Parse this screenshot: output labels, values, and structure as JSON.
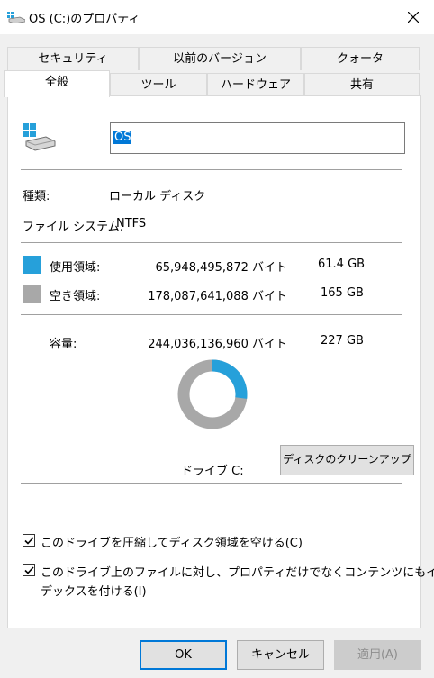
{
  "window": {
    "title": "OS (C:)のプロパティ",
    "icon": "drive-icon",
    "close_icon": "close-icon"
  },
  "tabs_row1": [
    {
      "label": "セキュリティ"
    },
    {
      "label": "以前のバージョン"
    },
    {
      "label": "クォータ"
    }
  ],
  "tabs_row2": [
    {
      "label": "全般",
      "active": true
    },
    {
      "label": "ツール"
    },
    {
      "label": "ハードウェア"
    },
    {
      "label": "共有"
    }
  ],
  "general": {
    "drive_name": "OS",
    "type_label": "種類:",
    "type_value": "ローカル ディスク",
    "fs_label": "ファイル システム:",
    "fs_value": "NTFS",
    "used_label": "使用領域:",
    "used_bytes": "65,948,495,872 バイト",
    "used_size": "61.4 GB",
    "free_label": "空き領域:",
    "free_bytes": "178,087,641,088 バイト",
    "free_size": "165 GB",
    "capacity_label": "容量:",
    "capacity_bytes": "244,036,136,960 バイト",
    "capacity_size": "227 GB",
    "drive_label": "ドライブ C:",
    "cleanup_button": "ディスクのクリーンアップ(D)",
    "used_fraction": 0.27,
    "compress_label": "このドライブを圧縮してディスク領域を空ける(C)",
    "compress_checked": true,
    "index_label_line1": "このドライブ上のファイルに対し、プロパティだけでなくコンテンツにもイン",
    "index_label_line2": "デックスを付ける(I)",
    "index_checked": true
  },
  "buttons": {
    "ok": "OK",
    "cancel": "キャンセル",
    "apply": "適用(A)"
  },
  "colors": {
    "used": "#26a0da",
    "free": "#a8a8a8",
    "accent": "#0078d7"
  }
}
